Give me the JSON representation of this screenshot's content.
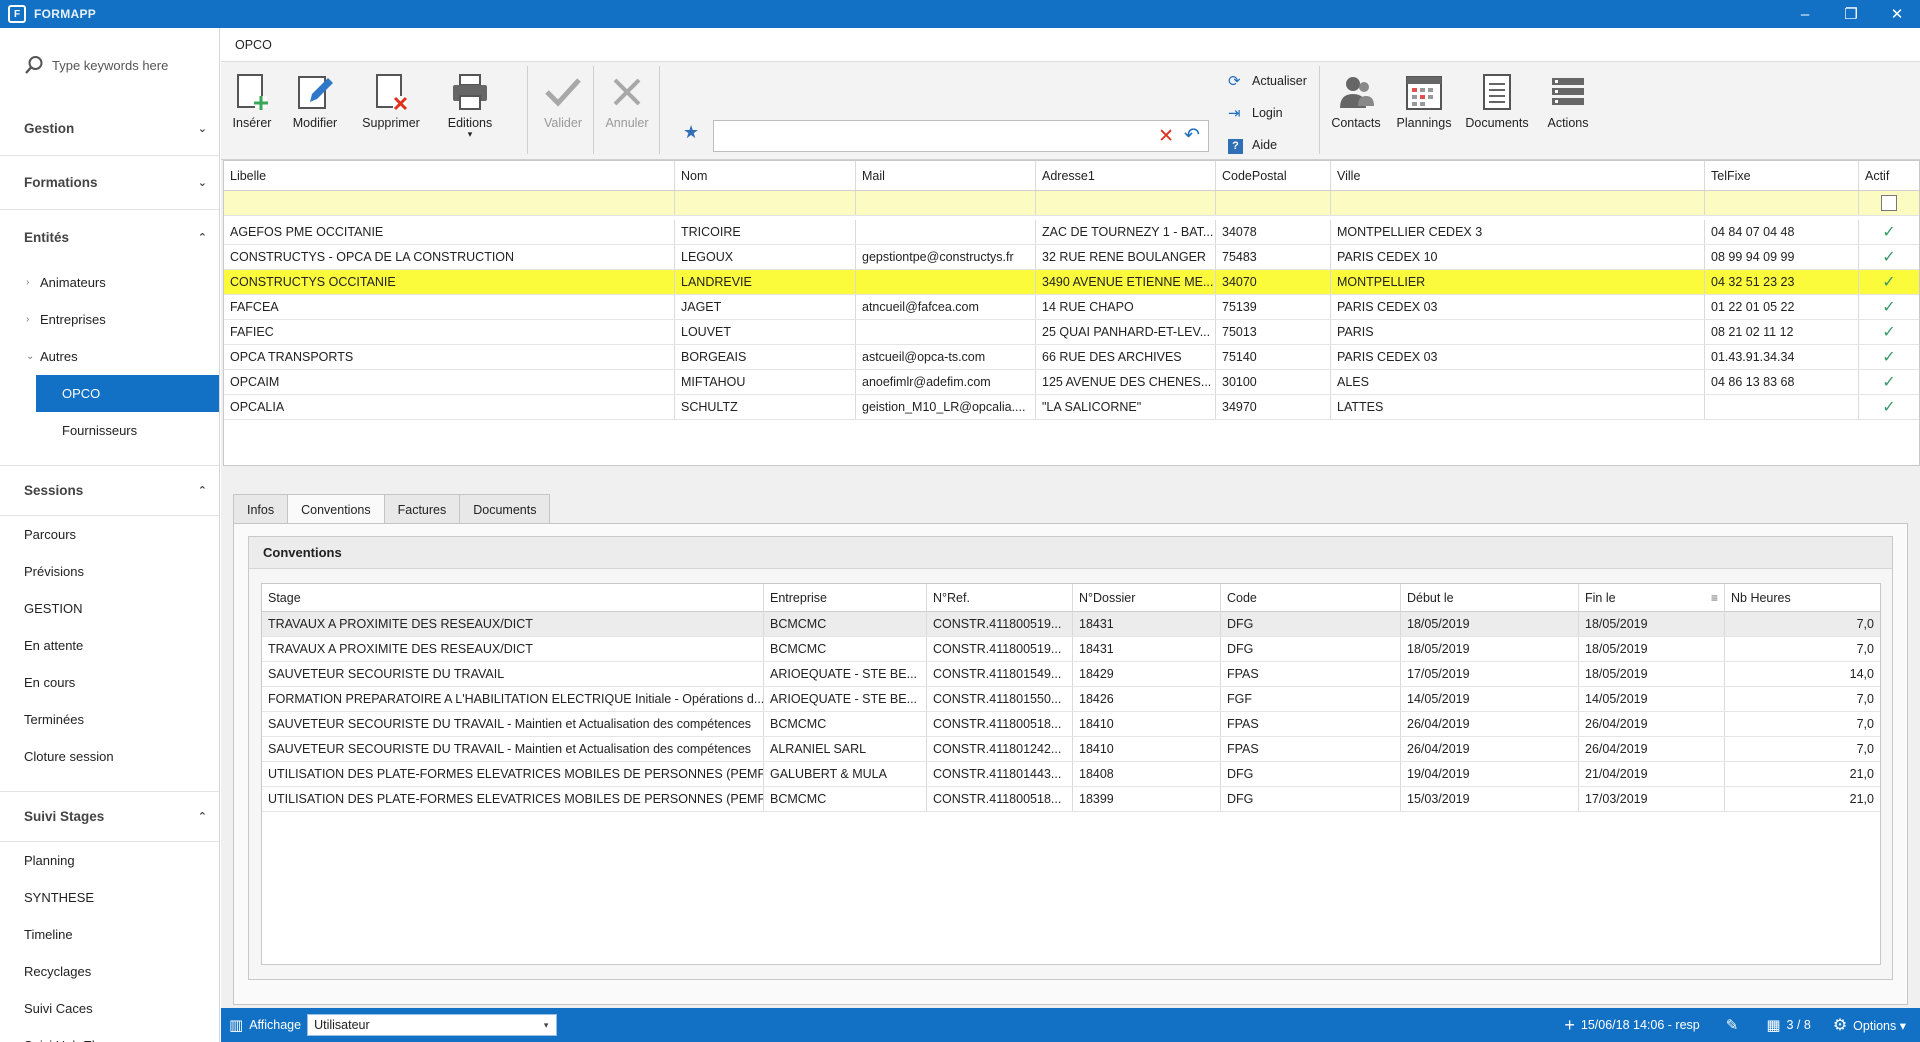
{
  "app": {
    "title": "FORMAPP",
    "logo": "F",
    "colors": {
      "accent": "#1271c4",
      "selected_row": "#fbfb3c",
      "filter_row": "#fcfcc2"
    }
  },
  "window_controls": {
    "minimize": "–",
    "restore": "❐",
    "close": "✕"
  },
  "sidebar": {
    "search_placeholder": "Type keywords here",
    "sections": [
      {
        "label": "Gestion",
        "chev": "⌄"
      },
      {
        "label": "Formations",
        "chev": "⌄"
      },
      {
        "label": "Entités",
        "chev": "⌃"
      },
      {
        "label": "Sessions",
        "chev": "⌃"
      },
      {
        "label": "Suivi Stages",
        "chev": "⌃"
      }
    ],
    "entites_items": [
      "Animateurs",
      "Entreprises",
      "Autres"
    ],
    "arrows": {
      "collapsed": "›",
      "expanded": "⌄"
    },
    "autres_items": [
      "OPCO",
      "Fournisseurs"
    ],
    "sessions_items": [
      "Parcours",
      "Prévisions",
      "GESTION",
      "En attente",
      "En cours",
      "Terminées",
      "Cloture session"
    ],
    "suivi_items": [
      "Planning",
      "SYNTHESE",
      "Timeline",
      "Recyclages",
      "Suivi Caces",
      "Suivi Hab.Elec."
    ]
  },
  "page_title": "OPCO",
  "ribbon": {
    "inserer": "Insérer",
    "modifier": "Modifier",
    "supprimer": "Supprimer",
    "editions": "Editions",
    "editions_dd": "▾",
    "valider": "Valider",
    "annuler": "Annuler",
    "actualiser": "Actualiser",
    "login": "Login",
    "aide": "Aide",
    "contacts": "Contacts",
    "plannings": "Plannings",
    "documents": "Documents",
    "actions": "Actions",
    "search_value": "",
    "star": "★",
    "clear": "✕",
    "undo": "↶",
    "icons": {
      "refresh": "⟳",
      "login": "⇥",
      "help": "?"
    }
  },
  "opco_grid": {
    "columns": [
      "Libelle",
      "Nom",
      "Mail",
      "Adresse1",
      "CodePostal",
      "Ville",
      "TelFixe",
      "Actif"
    ],
    "check": "✓",
    "rows": [
      [
        "AGEFOS PME OCCITANIE",
        "TRICOIRE",
        "",
        "ZAC DE TOURNEZY 1 - BAT...",
        "34078",
        "MONTPELLIER CEDEX 3",
        "04 84 07 04 48"
      ],
      [
        "CONSTRUCTYS - OPCA DE LA CONSTRUCTION",
        "LEGOUX",
        "gepstiontpe@constructys.fr",
        "32 RUE RENE BOULANGER",
        "75483",
        "PARIS CEDEX 10",
        "08 99 94 09 99"
      ],
      [
        "CONSTRUCTYS OCCITANIE",
        "LANDREVIE",
        "",
        "3490 AVENUE ETIENNE ME...",
        "34070",
        "MONTPELLIER",
        "04 32 51 23 23"
      ],
      [
        "FAFCEA",
        "JAGET",
        "atncueil@fafcea.com",
        "14 RUE CHAPO",
        "75139",
        "PARIS CEDEX 03",
        "01 22 01 05 22"
      ],
      [
        "FAFIEC",
        "LOUVET",
        "",
        "25 QUAI PANHARD-ET-LEV...",
        "75013",
        "PARIS",
        "08 21 02 11 12"
      ],
      [
        "OPCA TRANSPORTS",
        "BORGEAIS",
        "astcueil@opca-ts.com",
        "66 RUE DES ARCHIVES",
        "75140",
        "PARIS CEDEX 03",
        "01.43.91.34.34"
      ],
      [
        "OPCAIM",
        "MIFTAHOU",
        "anoefimlr@adefim.com",
        "125 AVENUE DES CHENES...",
        "30100",
        "ALES",
        "04 86 13 83 68"
      ],
      [
        "OPCALIA",
        "SCHULTZ",
        "geistion_M10_LR@opcalia....",
        "\"LA SALICORNE\"",
        "34970",
        "LATTES",
        ""
      ]
    ]
  },
  "tabs": [
    "Infos",
    "Conventions",
    "Factures",
    "Documents"
  ],
  "conventions": {
    "title": "Conventions",
    "columns": [
      "Stage",
      "Entreprise",
      "N°Ref.",
      "N°Dossier",
      "Code",
      "Début le",
      "Fin le",
      "Nb Heures"
    ],
    "filter_icon": "≡",
    "rows": [
      [
        "TRAVAUX A PROXIMITE DES RESEAUX/DICT",
        "BCMCMC",
        "CONSTR.411800519...",
        "18431",
        "DFG",
        "18/05/2019",
        "18/05/2019",
        "7,0"
      ],
      [
        "TRAVAUX A PROXIMITE DES RESEAUX/DICT",
        "BCMCMC",
        "CONSTR.411800519...",
        "18431",
        "DFG",
        "18/05/2019",
        "18/05/2019",
        "7,0"
      ],
      [
        "SAUVETEUR SECOURISTE DU TRAVAIL",
        "ARIOEQUATE - STE BE...",
        "CONSTR.411801549...",
        "18429",
        "FPAS",
        "17/05/2019",
        "18/05/2019",
        "14,0"
      ],
      [
        "FORMATION PREPARATOIRE A L'HABILITATION ELECTRIQUE Initiale - Opérations d...",
        "ARIOEQUATE - STE BE...",
        "CONSTR.411801550...",
        "18426",
        "FGF",
        "14/05/2019",
        "14/05/2019",
        "7,0"
      ],
      [
        "SAUVETEUR SECOURISTE DU TRAVAIL - Maintien et Actualisation des compétences",
        "BCMCMC",
        "CONSTR.411800518...",
        "18410",
        "FPAS",
        "26/04/2019",
        "26/04/2019",
        "7,0"
      ],
      [
        "SAUVETEUR SECOURISTE DU TRAVAIL - Maintien et Actualisation des compétences",
        "ALRANIEL SARL",
        "CONSTR.411801242...",
        "18410",
        "FPAS",
        "26/04/2019",
        "26/04/2019",
        "7,0"
      ],
      [
        "UTILISATION DES PLATE-FORMES ELEVATRICES MOBILES DE PERSONNES (PEMP)...",
        "GALUBERT & MULA",
        "CONSTR.411801443...",
        "18408",
        "DFG",
        "19/04/2019",
        "21/04/2019",
        "21,0"
      ],
      [
        "UTILISATION DES PLATE-FORMES ELEVATRICES MOBILES DE PERSONNES (PEMP)...",
        "BCMCMC",
        "CONSTR.411800518...",
        "18399",
        "DFG",
        "15/03/2019",
        "17/03/2019",
        "21,0"
      ]
    ]
  },
  "statusbar": {
    "affichage_label": "Affichage",
    "affichage_value": "Utilisateur",
    "dd": "▾",
    "plus": "+",
    "stamp": "15/06/18 14:06 - resp",
    "pencil": "✎",
    "grid_icon": "▦",
    "record_count": "3 / 8",
    "gear": "⚙",
    "options": "Options ▾",
    "view_icon": "▥"
  }
}
